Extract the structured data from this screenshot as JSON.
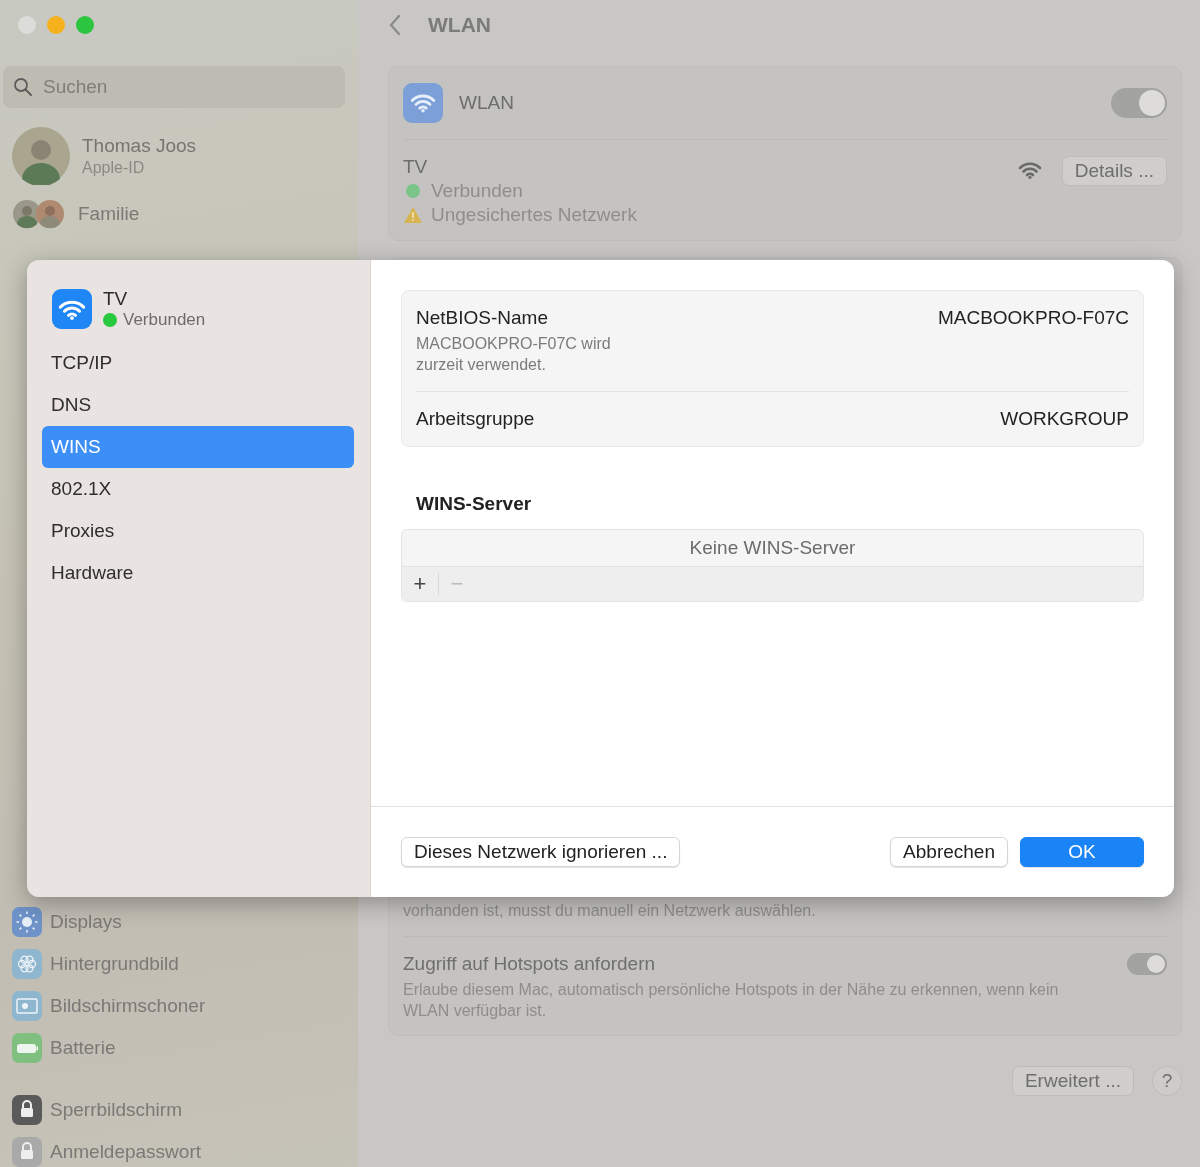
{
  "sidebar": {
    "search": {
      "placeholder": "Suchen"
    },
    "account": {
      "name": "Thomas Joos",
      "subtitle": "Apple-ID"
    },
    "family": {
      "label": "Familie"
    },
    "groups": [
      [
        {
          "label": "Displays",
          "kind": "display"
        },
        {
          "label": "Hintergrundbild",
          "kind": "wallpaper"
        },
        {
          "label": "Bildschirmschoner",
          "kind": "screensaver"
        },
        {
          "label": "Batterie",
          "kind": "battery"
        }
      ],
      [
        {
          "label": "Sperrbildschirm",
          "kind": "lockscreen"
        },
        {
          "label": "Anmeldepasswort",
          "kind": "password"
        }
      ]
    ]
  },
  "page": {
    "title": "WLAN",
    "wlan": {
      "label": "WLAN",
      "on": true,
      "network": {
        "name": "TV",
        "status": "Verbunden",
        "warning": "Ungesichertes Netzwerk",
        "button": "Details ..."
      }
    },
    "partial_text": "vorhanden ist, musst du manuell ein Netzwerk auswählen.",
    "hotspot": {
      "title": "Zugriff auf Hotspots anfordern",
      "description": "Erlaube diesem Mac, automatisch persönliche Hotspots in der Nähe zu erkennen, wenn kein WLAN verfügbar ist.",
      "on": true
    },
    "advanced_button": "Erweitert ...",
    "help_button": "?"
  },
  "dialog": {
    "network": {
      "name": "TV",
      "status": "Verbunden"
    },
    "tabs": [
      {
        "label": "TCP/IP",
        "selected": false
      },
      {
        "label": "DNS",
        "selected": false
      },
      {
        "label": "WINS",
        "selected": true
      },
      {
        "label": "802.1X",
        "selected": false
      },
      {
        "label": "Proxies",
        "selected": false
      },
      {
        "label": "Hardware",
        "selected": false
      }
    ],
    "netbios": {
      "label": "NetBIOS-Name",
      "value": "MACBOOKPRO-F07C",
      "note": "MACBOOKPRO-F07C wird zurzeit verwendet."
    },
    "workgroup": {
      "label": "Arbeitsgruppe",
      "value": "WORKGROUP"
    },
    "wins": {
      "title": "WINS-Server",
      "empty": "Keine WINS-Server",
      "controls": [
        {
          "label": "+",
          "disabled": false
        },
        {
          "label": "−",
          "disabled": true
        }
      ]
    },
    "ignore_button": "Dieses Netzwerk ignorieren ...",
    "cancel_button": "Abbrechen",
    "ok_button": "OK"
  }
}
